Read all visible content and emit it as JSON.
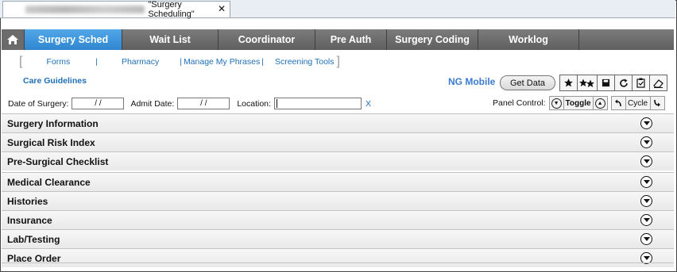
{
  "doc_tab": {
    "title": "\"Surgery Scheduling\"",
    "close": "✕"
  },
  "nav": {
    "home_icon": "home-icon",
    "tabs": [
      {
        "label": "Surgery Sched",
        "active": true
      },
      {
        "label": "Wait List"
      },
      {
        "label": "Coordinator"
      },
      {
        "label": "Pre Auth"
      },
      {
        "label": "Surgery Coding"
      },
      {
        "label": "Worklog"
      }
    ]
  },
  "sublinks": [
    "Forms",
    "Pharmacy",
    "Manage My Phrases",
    "Screening Tools"
  ],
  "care_guidelines": "Care Guidelines",
  "ng_mobile": "NG Mobile",
  "get_data": "Get Data",
  "fields": {
    "date_of_surgery": {
      "label": "Date of Surgery:",
      "value": "/ /"
    },
    "admit_date": {
      "label": "Admit Date:",
      "value": "/ /"
    },
    "location": {
      "label": "Location:",
      "value": "",
      "clear": "X"
    }
  },
  "panel_control": {
    "label": "Panel Control:",
    "toggle": "Toggle",
    "cycle": "Cycle"
  },
  "sections": [
    "Surgery Information",
    "Surgical Risk Index",
    "Pre-Surgical Checklist",
    "Medical Clearance",
    "Histories",
    "Insurance",
    "Lab/Testing",
    "Place Order"
  ],
  "colors": {
    "accent": "#2f86cf",
    "link": "#1f6fb5",
    "nav_bg": "#6b6b6b"
  }
}
